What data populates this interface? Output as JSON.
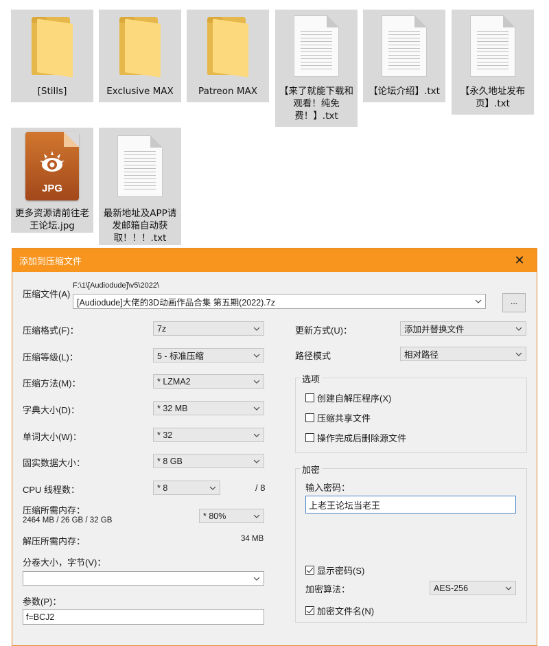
{
  "files": [
    {
      "type": "folder",
      "icon": "folder-icon",
      "name": "[Stills]"
    },
    {
      "type": "folder",
      "icon": "folder-icon",
      "name": "Exclusive MAX"
    },
    {
      "type": "folder",
      "icon": "folder-icon",
      "name": "Patreon MAX"
    },
    {
      "type": "doc",
      "icon": "text-file-icon",
      "name": "【来了就能下载和观看！纯免费！】.txt"
    },
    {
      "type": "doc",
      "icon": "text-file-icon",
      "name": "【论坛介绍】.txt"
    },
    {
      "type": "doc",
      "icon": "text-file-icon",
      "name": "【永久地址发布页】.txt"
    },
    {
      "type": "jpg",
      "icon": "jpg-file-icon",
      "ext": "JPG",
      "name": "更多资源请前往老王论坛.jpg"
    },
    {
      "type": "doc",
      "icon": "text-file-icon",
      "name": "最新地址及APP请发邮箱自动获取！！！.txt"
    }
  ],
  "dialog": {
    "title": "添加到压缩文件",
    "close": "✕",
    "archive_label": "压缩文件(A)",
    "archive_path": "F:\\1\\[Audiodude]\\v5\\2022\\",
    "archive_name": "[Audiodude]大佬的3D动画作品合集 第五期(2022).7z",
    "browse": "...",
    "left": {
      "format_label": "压缩格式(F)：",
      "format": "7z",
      "level_label": "压缩等级(L)：",
      "level": "5 - 标准压缩",
      "method_label": "压缩方法(M)：",
      "method": "* LZMA2",
      "dict_label": "字典大小(D)：",
      "dict": "* 32 MB",
      "word_label": "单词大小(W)：",
      "word": "* 32",
      "solid_label": "固实数据大小：",
      "solid": "* 8 GB",
      "cpu_label": "CPU 线程数：",
      "cpu": "* 8",
      "cpu_max": "/ 8",
      "mem_label": "压缩所需内存：",
      "mem_values": "2464 MB / 26 GB / 32 GB",
      "mem_pct": "* 80%",
      "decomp_label": "解压所需内存：",
      "decomp_value": "34 MB",
      "volume_label": "分卷大小，字节(V)：",
      "volume": "",
      "params_label": "参数(P)：",
      "params": "f=BCJ2"
    },
    "right": {
      "update_label": "更新方式(U)：",
      "update": "添加并替换文件",
      "path_label": "路径模式",
      "path": "相对路径",
      "options_title": "选项",
      "opt_sfx": "创建自解压程序(X)",
      "opt_shared": "压缩共享文件",
      "opt_delete": "操作完成后删除源文件",
      "enc_title": "加密",
      "pwd_label": "输入密码：",
      "pwd": "上老王论坛当老王",
      "show_pwd": "显示密码(S)",
      "algo_label": "加密算法：",
      "algo": "AES-256",
      "enc_names": "加密文件名(N)"
    }
  }
}
